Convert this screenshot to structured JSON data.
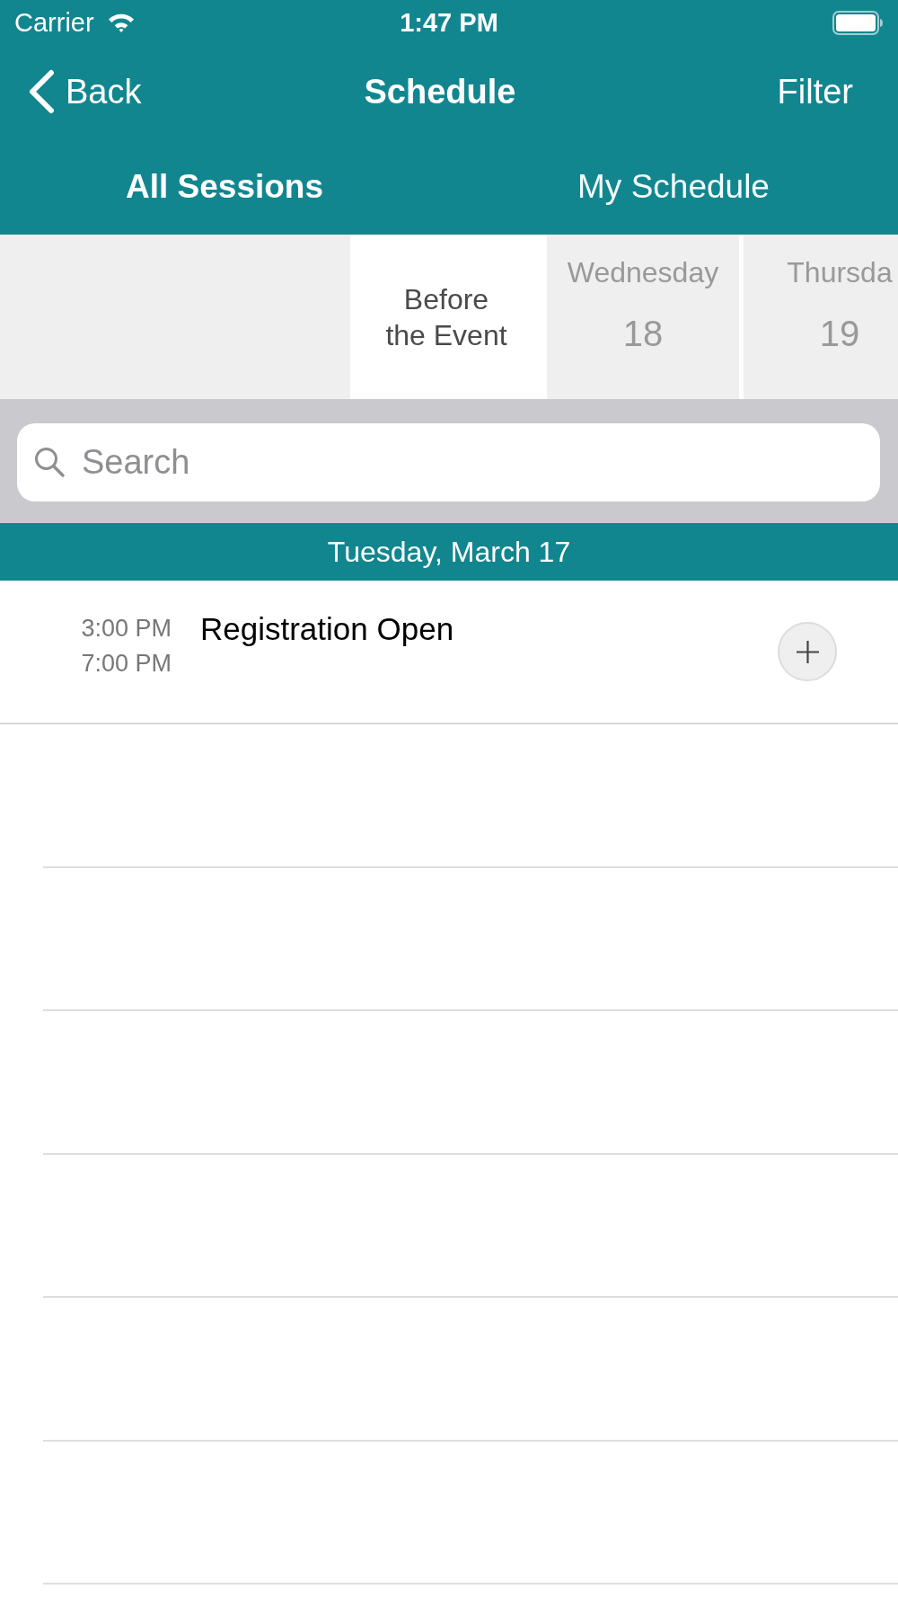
{
  "status_bar": {
    "carrier": "Carrier",
    "time": "1:47 PM"
  },
  "nav_bar": {
    "back": "Back",
    "title": "Schedule",
    "right_button": "Filter"
  },
  "tabs": [
    {
      "label": "All Sessions",
      "selected": true
    },
    {
      "label": "My Schedule",
      "selected": false
    }
  ],
  "days": [
    {
      "kind": "period",
      "label": "Before the Event",
      "selected": true
    },
    {
      "kind": "date",
      "weekday": "Wednesday",
      "day": "18",
      "selected": false
    },
    {
      "kind": "date",
      "weekday": "Thursda",
      "day": "19",
      "selected": false
    }
  ],
  "search": {
    "placeholder": "Search"
  },
  "sections": [
    {
      "header": "Tuesday, March 17",
      "sessions": [
        {
          "start": "3:00 PM",
          "end": "7:00 PM",
          "title": "Registration Open"
        }
      ]
    }
  ]
}
